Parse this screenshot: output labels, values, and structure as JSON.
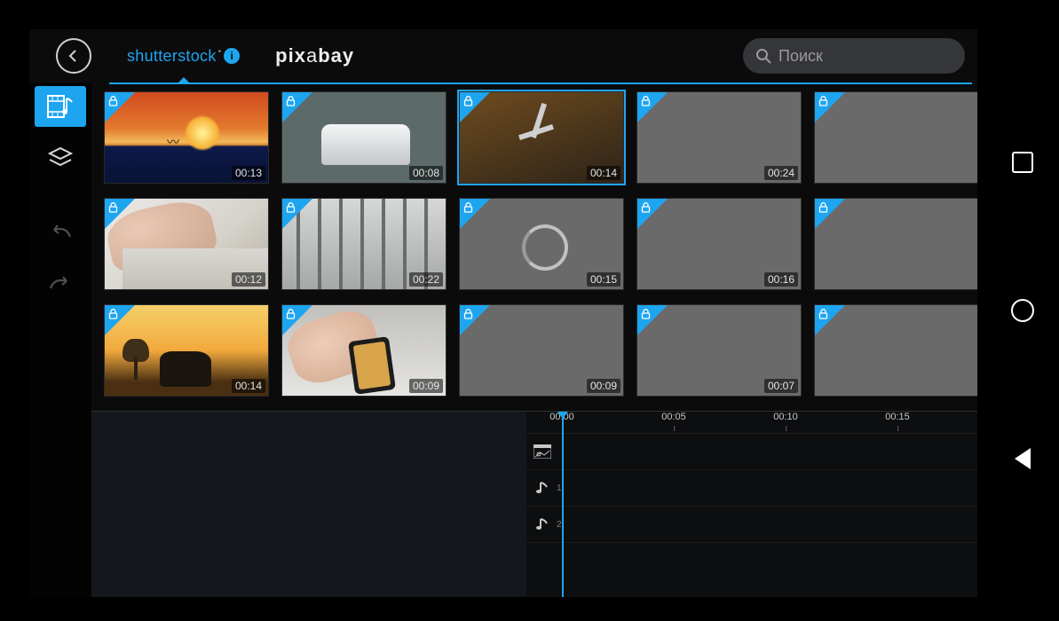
{
  "search": {
    "placeholder": "Поиск"
  },
  "tabs": {
    "shutterstock": "shutterstock",
    "pixabay_a": "pix",
    "pixabay_b": "a",
    "pixabay_c": "bay"
  },
  "sidebar": {
    "media": "media-music",
    "layers": "layers",
    "undo": "undo",
    "redo": "redo"
  },
  "clips": [
    {
      "dur": "00:13",
      "kind": "sunset"
    },
    {
      "dur": "00:08",
      "kind": "factory"
    },
    {
      "dur": "00:14",
      "kind": "robot",
      "active": true
    },
    {
      "dur": "00:24",
      "kind": "blank"
    },
    {
      "dur": "",
      "kind": "blank"
    },
    {
      "dur": "00:12",
      "kind": "typing"
    },
    {
      "dur": "00:22",
      "kind": "airport"
    },
    {
      "dur": "00:15",
      "kind": "loading"
    },
    {
      "dur": "00:16",
      "kind": "blank"
    },
    {
      "dur": "",
      "kind": "blank"
    },
    {
      "dur": "00:14",
      "kind": "savanna"
    },
    {
      "dur": "00:09",
      "kind": "hands"
    },
    {
      "dur": "00:09",
      "kind": "blank"
    },
    {
      "dur": "00:07",
      "kind": "blank"
    },
    {
      "dur": "",
      "kind": "blank"
    }
  ],
  "timeline": {
    "ticks": [
      "00:00",
      "00:05",
      "00:10",
      "00:15"
    ],
    "tracks": {
      "video": "V",
      "audio1": "1",
      "audio2": "2"
    }
  }
}
